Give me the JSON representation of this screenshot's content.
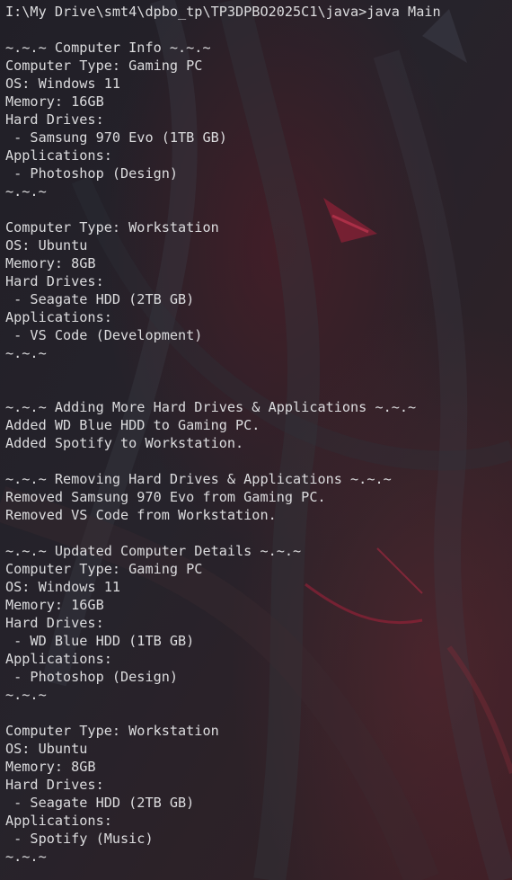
{
  "window": {
    "background_color": "#1c1a21",
    "text_color": "#dcdcde",
    "accent_red": "#a8203a"
  },
  "terminal": {
    "prompt": "I:\\My Drive\\smt4\\dpbo_tp\\TP3DPBO2025C1\\java>",
    "command": "java Main",
    "output": [
      "",
      "~.~.~ Computer Info ~.~.~",
      "Computer Type: Gaming PC",
      "OS: Windows 11",
      "Memory: 16GB",
      "Hard Drives:",
      " - Samsung 970 Evo (1TB GB)",
      "Applications:",
      " - Photoshop (Design)",
      "~.~.~",
      "",
      "Computer Type: Workstation",
      "OS: Ubuntu",
      "Memory: 8GB",
      "Hard Drives:",
      " - Seagate HDD (2TB GB)",
      "Applications:",
      " - VS Code (Development)",
      "~.~.~",
      "",
      "",
      "~.~.~ Adding More Hard Drives & Applications ~.~.~",
      "Added WD Blue HDD to Gaming PC.",
      "Added Spotify to Workstation.",
      "",
      "~.~.~ Removing Hard Drives & Applications ~.~.~",
      "Removed Samsung 970 Evo from Gaming PC.",
      "Removed VS Code from Workstation.",
      "",
      "~.~.~ Updated Computer Details ~.~.~",
      "Computer Type: Gaming PC",
      "OS: Windows 11",
      "Memory: 16GB",
      "Hard Drives:",
      " - WD Blue HDD (1TB GB)",
      "Applications:",
      " - Photoshop (Design)",
      "~.~.~",
      "",
      "Computer Type: Workstation",
      "OS: Ubuntu",
      "Memory: 8GB",
      "Hard Drives:",
      " - Seagate HDD (2TB GB)",
      "Applications:",
      " - Spotify (Music)",
      "~.~.~"
    ]
  }
}
